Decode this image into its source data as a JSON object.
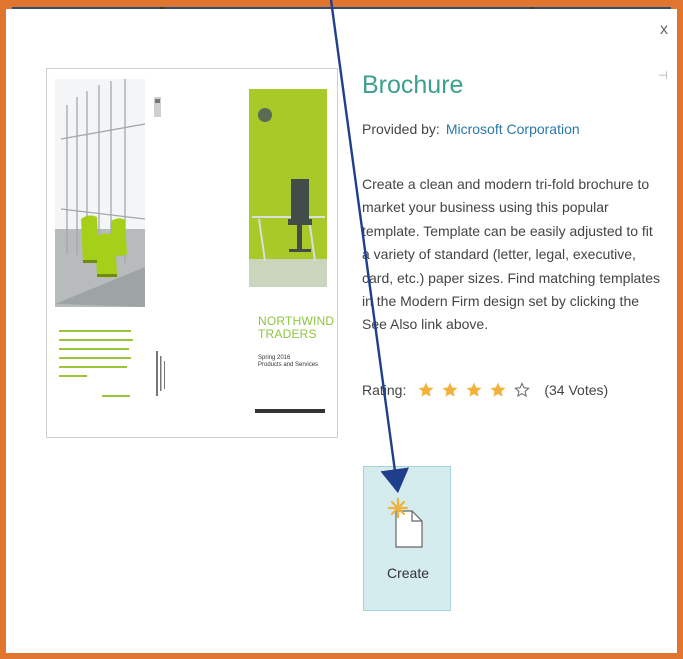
{
  "window": {
    "close_label": "x",
    "pin_label": "⊣"
  },
  "template": {
    "thumbnail": {
      "brand_line1": "NORTHWIND",
      "brand_line2": "TRADERS",
      "season": "Spring 2016",
      "subtitle": "Products and Services"
    },
    "title": "Brochure",
    "provided_by_label": "Provided by:",
    "provider": "Microsoft Corporation",
    "description": "Create a clean and modern tri-fold brochure to market your business using this popular template. Template can be easily adjusted to fit a variety of standard (letter, legal, executive, card, etc.) paper sizes. Find matching templates in the Modern Firm design set by clicking the See Also link above.",
    "rating_label": "Rating:",
    "rating_value": 4,
    "rating_max": 5,
    "votes_text": "(34 Votes)"
  },
  "actions": {
    "create_label": "Create"
  },
  "colors": {
    "accent": "#3c9f8f",
    "link": "#2b78a8",
    "frame": "#e0752f",
    "annotation_arrow": "#1f3f8c",
    "star_filled": "#f0b23a",
    "create_tile": "#d5ecee"
  }
}
